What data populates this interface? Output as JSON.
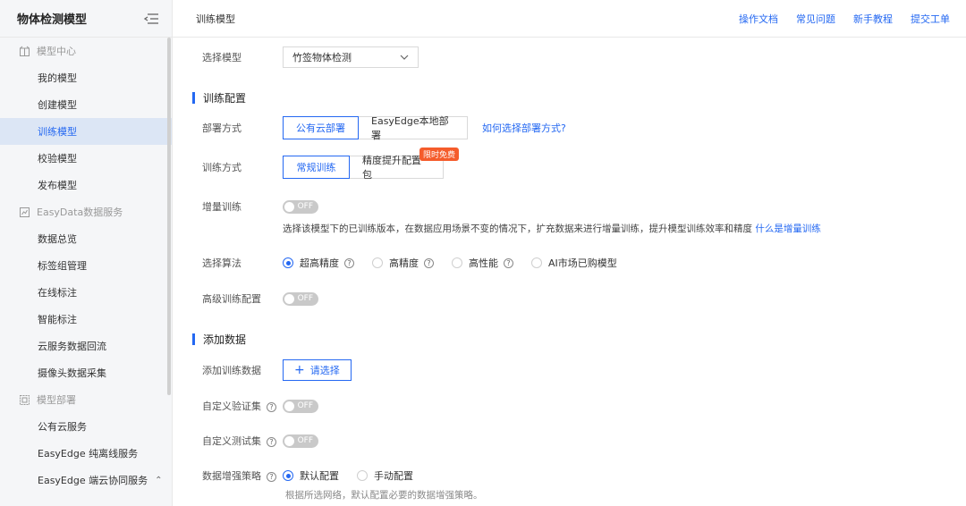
{
  "sidebar": {
    "title": "物体检测模型",
    "sections": [
      {
        "label": "模型中心",
        "icon": "cube-icon",
        "items": [
          {
            "label": "我的模型"
          },
          {
            "label": "创建模型"
          },
          {
            "label": "训练模型",
            "active": true
          },
          {
            "label": "校验模型"
          },
          {
            "label": "发布模型"
          }
        ]
      },
      {
        "label": "EasyData数据服务",
        "icon": "data-icon",
        "items": [
          {
            "label": "数据总览"
          },
          {
            "label": "标签组管理"
          },
          {
            "label": "在线标注"
          },
          {
            "label": "智能标注"
          },
          {
            "label": "云服务数据回流"
          },
          {
            "label": "摄像头数据采集"
          }
        ]
      },
      {
        "label": "模型部署",
        "icon": "deploy-icon",
        "items": [
          {
            "label": "公有云服务"
          },
          {
            "label": "EasyEdge 纯离线服务"
          },
          {
            "label": "EasyEdge 端云协同服务"
          }
        ]
      }
    ]
  },
  "topbar": {
    "title": "训练模型",
    "links": [
      "操作文档",
      "常见问题",
      "新手教程",
      "提交工单"
    ]
  },
  "form": {
    "select_model_label": "选择模型",
    "select_model_value": "竹签物体检测",
    "train_config_title": "训练配置",
    "deploy_label": "部署方式",
    "deploy_options": [
      "公有云部署",
      "EasyEdge本地部署"
    ],
    "deploy_link": "如何选择部署方式?",
    "train_mode_label": "训练方式",
    "train_mode_options": [
      "常规训练",
      "精度提升配置包"
    ],
    "train_mode_badge": "限时免费",
    "incremental_label": "增量训练",
    "toggle_off": "OFF",
    "incremental_desc": "选择该模型下的已训练版本，在数据应用场景不变的情况下，扩充数据来进行增量训练，提升模型训练效率和精度",
    "incremental_link": "什么是增量训练",
    "algo_label": "选择算法",
    "algo_options": [
      "超高精度",
      "高精度",
      "高性能",
      "AI市场已购模型"
    ],
    "advanced_label": "高级训练配置",
    "add_data_title": "添加数据",
    "add_train_data_label": "添加训练数据",
    "add_button": "请选择",
    "custom_val_label": "自定义验证集",
    "custom_test_label": "自定义测试集",
    "augment_label": "数据增强策略",
    "augment_options": [
      "默认配置",
      "手动配置"
    ],
    "augment_desc": "根据所选网络，默认配置必要的数据增强策略。"
  }
}
